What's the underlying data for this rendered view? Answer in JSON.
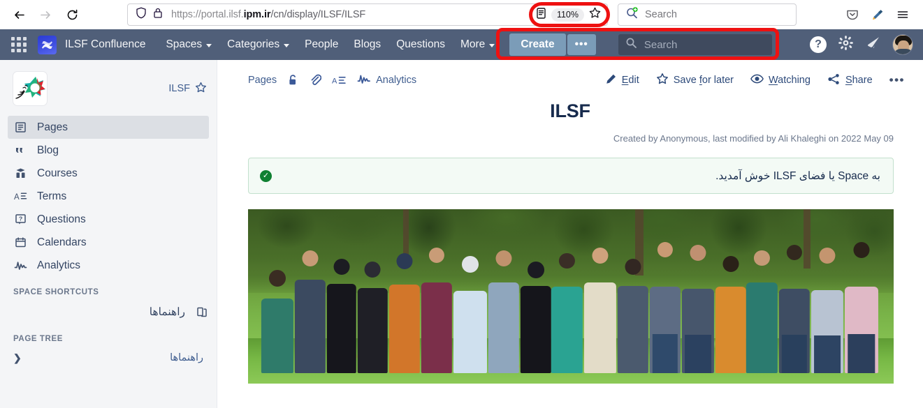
{
  "browser": {
    "back_label": "Back",
    "forward_label": "Forward",
    "reload_label": "Reload",
    "url_full": "https://portal.ilsf.ipm.ir/cn/display/ILSF/ILSF",
    "url_scheme": "https://portal.ilsf.",
    "url_host_bold": "ipm.ir",
    "url_path": "/cn/display/ILSF/ILSF",
    "zoom_level": "110%",
    "search_placeholder": "Search",
    "accent_annotation_color": "#ee1111"
  },
  "confluence_nav": {
    "brand": "ILSF Confluence",
    "items": [
      {
        "label": "Spaces",
        "has_caret": true
      },
      {
        "label": "Categories",
        "has_caret": true
      },
      {
        "label": "People",
        "has_caret": false
      },
      {
        "label": "Blogs",
        "has_caret": false
      },
      {
        "label": "Questions",
        "has_caret": false
      },
      {
        "label": "More",
        "has_caret": true
      }
    ],
    "create_label": "Create",
    "more_dots_label": "•••",
    "search_placeholder": "Search",
    "help_label": "?",
    "bar_color": "#505f79",
    "create_button_color": "#7b9cb8"
  },
  "sidebar": {
    "space_name": "ILSF",
    "items": [
      {
        "label": "Pages",
        "icon": "page-list-icon",
        "active": true
      },
      {
        "label": "Blog",
        "icon": "quote-icon",
        "active": false
      },
      {
        "label": "Courses",
        "icon": "courses-icon",
        "active": false
      },
      {
        "label": "Terms",
        "icon": "terms-icon",
        "active": false
      },
      {
        "label": "Questions",
        "icon": "question-box-icon",
        "active": false
      },
      {
        "label": "Calendars",
        "icon": "calendar-icon",
        "active": false
      },
      {
        "label": "Analytics",
        "icon": "analytics-icon",
        "active": false
      }
    ],
    "shortcuts_header": "SPACE SHORTCUTS",
    "shortcuts": [
      {
        "label": "راهنماها",
        "icon": "pages-copy-icon"
      }
    ],
    "page_tree_header": "PAGE TREE",
    "page_tree": [
      {
        "label": "راهنماها",
        "expand": "❯"
      }
    ]
  },
  "page": {
    "breadcrumb": "Pages",
    "analytics_label": "Analytics",
    "actions": [
      {
        "label": "Edit",
        "icon": "pencil-icon"
      },
      {
        "label": "Save for later",
        "icon": "star-icon"
      },
      {
        "label": "Watching",
        "icon": "eye-icon"
      },
      {
        "label": "Share",
        "icon": "share-icon"
      }
    ],
    "overflow_label": "•••",
    "title": "ILSF",
    "meta": "Created by Anonymous, last modified by Ali Khaleghi on 2022 May 09",
    "panel": {
      "text": "به Space یا فضای ILSF خوش آمدید.",
      "icon": "check-circle-icon",
      "bg_color": "#f3faf5",
      "border_color": "#c3e0cd",
      "check_color": "#0f8032"
    },
    "image_alt": "ILSF group photo of staff standing on grass in front of trees"
  }
}
